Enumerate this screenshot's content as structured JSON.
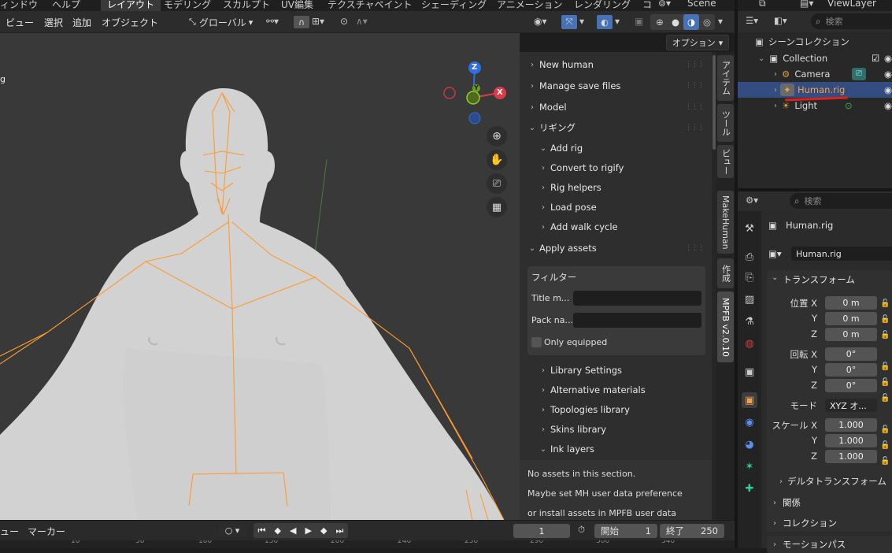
{
  "topbar": {
    "menus": [
      "ィンドウ",
      "ヘルプ"
    ],
    "workspaces": [
      "レイアウト",
      "モデリング",
      "スカルプト",
      "UV編集",
      "テクスチャペイント",
      "シェーディング",
      "アニメーション",
      "レンダリング",
      "コ"
    ],
    "scene": "Scene",
    "viewlayer": "ViewLayer"
  },
  "viewport_header": {
    "menus": [
      "ビュー",
      "選択",
      "追加",
      "オブジェクト"
    ],
    "orientation": "グローバル",
    "options": "オプション"
  },
  "viewport": {
    "corner_text": "g",
    "gizmo": {
      "z": "Z",
      "y": "Y",
      "x": "X"
    }
  },
  "npanel": {
    "items": [
      {
        "label": "New human",
        "chevron": "›",
        "grip": true
      },
      {
        "label": "Manage save files",
        "chevron": "›",
        "grip": true
      },
      {
        "label": "Model",
        "chevron": "›",
        "grip": true
      },
      {
        "label": "リギング",
        "chevron": "⌄",
        "grip": true
      },
      {
        "label": "Add rig",
        "chevron": "⌄",
        "grip": false
      },
      {
        "label": "Convert to rigify",
        "chevron": "›",
        "grip": false
      },
      {
        "label": "Rig helpers",
        "chevron": "›",
        "grip": false
      },
      {
        "label": "Load pose",
        "chevron": "›",
        "grip": false
      },
      {
        "label": "Add walk cycle",
        "chevron": "›",
        "grip": false
      },
      {
        "label": "Apply assets",
        "chevron": "⌄",
        "grip": true
      }
    ],
    "filter": {
      "title": "フィルター",
      "title_label": "Title m...",
      "pack_label": "Pack na...",
      "only_equipped": "Only equipped"
    },
    "subitems": [
      {
        "label": "Library Settings",
        "chevron": "›"
      },
      {
        "label": "Alternative materials",
        "chevron": "›"
      },
      {
        "label": "Topologies library",
        "chevron": "›"
      },
      {
        "label": "Skins library",
        "chevron": "›"
      },
      {
        "label": "Ink layers",
        "chevron": "⌄"
      }
    ],
    "messages": [
      "No assets in this section.",
      "Maybe set MH user data preference",
      "or install assets in MPFB user data"
    ]
  },
  "vtabs": [
    "アイテム",
    "ツール",
    "ビュー",
    "MakeHuman",
    "作成",
    "MPFB v2.0.10"
  ],
  "outliner": {
    "search_placeholder": "検索",
    "scene_collection": "シーンコレクション",
    "collection": "Collection",
    "objects": [
      {
        "name": "Camera",
        "color": "#dcdcdc",
        "selected": false
      },
      {
        "name": "Human.rig",
        "color": "#f0a050",
        "selected": true
      },
      {
        "name": "Light",
        "color": "#dcdcdc",
        "selected": false
      }
    ]
  },
  "properties": {
    "search_placeholder": "検索",
    "object_name": "Human.rig",
    "data_name": "Human.rig",
    "transform_title": "トランスフォーム",
    "location": {
      "label": "位置",
      "x": "0 m",
      "y": "0 m",
      "z": "0 m"
    },
    "rotation": {
      "label": "回転",
      "x": "0°",
      "y": "0°",
      "z": "0°"
    },
    "mode": {
      "label": "モード",
      "value": "XYZ オ..."
    },
    "scale": {
      "label": "スケール",
      "x": "1.000",
      "y": "1.000",
      "z": "1.000"
    },
    "axis": {
      "x": "X",
      "y": "Y",
      "z": "Z"
    },
    "delta": "デルタトランスフォーム",
    "sections": [
      "関係",
      "コレクション",
      "モーションパス"
    ]
  },
  "timeline": {
    "view": "ュー",
    "marker": "マーカー",
    "frame": "1",
    "start_label": "開始",
    "start": "1",
    "end_label": "終了",
    "end": "250",
    "ruler": [
      "10",
      "50",
      "100",
      "150",
      "200",
      "240",
      "250",
      "290",
      "300",
      "340"
    ]
  },
  "colors": {
    "accent": "#4772b3",
    "rig": "#ff9a30",
    "selected_text": "#f0a050"
  }
}
